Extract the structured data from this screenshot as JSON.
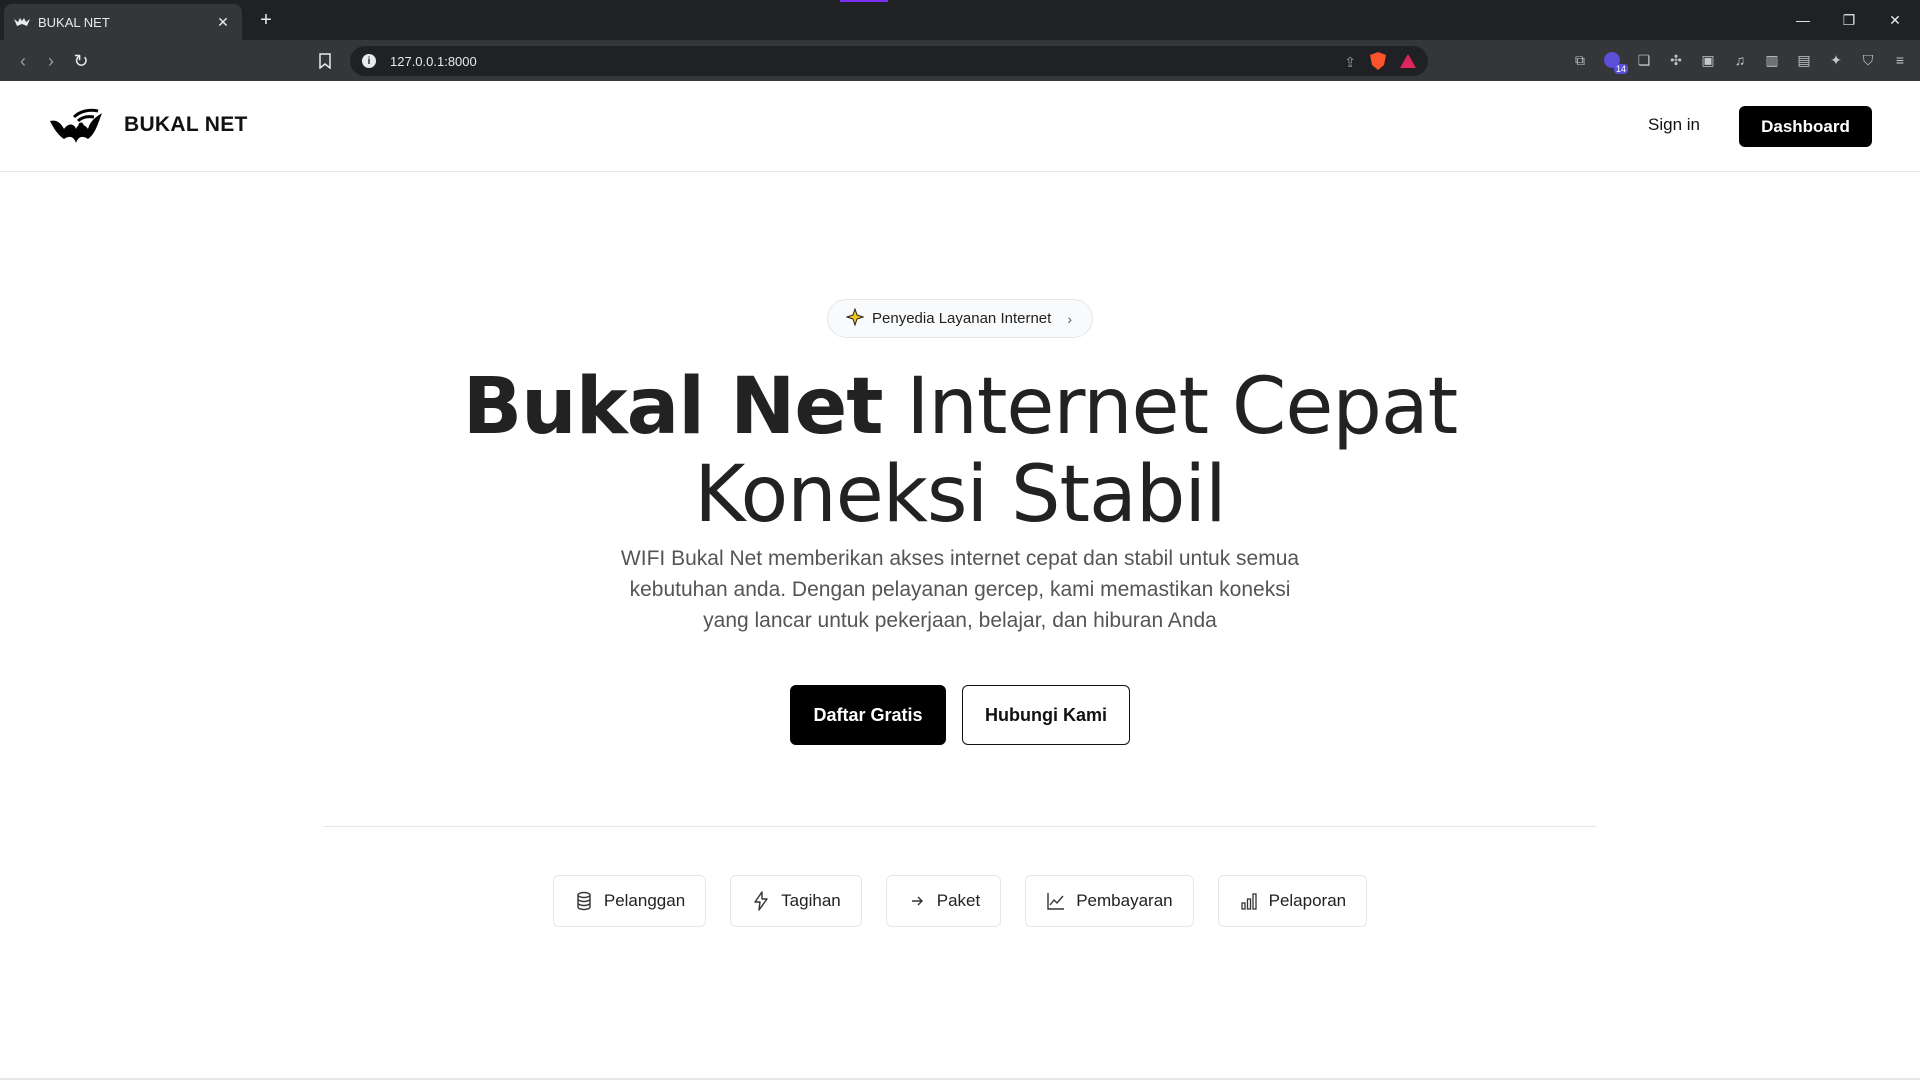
{
  "browser": {
    "tab_title": "BUKAL NET",
    "url": "127.0.0.1:8000",
    "extension_badge": "14"
  },
  "header": {
    "brand": "BUKAL NET",
    "signin_label": "Sign in",
    "dashboard_label": "Dashboard"
  },
  "hero": {
    "pill_label": "Penyedia Layanan Internet",
    "title_bold": "Bukal Net",
    "title_rest_line1": " Internet Cepat",
    "title_line2": "Koneksi Stabil",
    "description": "WIFI Bukal Net memberikan akses internet cepat dan stabil untuk semua kebutuhan anda. Dengan pelayanan gercep, kami memastikan koneksi yang lancar untuk pekerjaan, belajar, dan hiburan Anda",
    "primary_label": "Daftar Gratis",
    "secondary_label": "Hubungi Kami"
  },
  "features": [
    {
      "label": "Pelanggan",
      "icon": "database-icon"
    },
    {
      "label": "Tagihan",
      "icon": "lightning-icon"
    },
    {
      "label": "Paket",
      "icon": "arrow-right-icon"
    },
    {
      "label": "Pembayaran",
      "icon": "line-chart-icon"
    },
    {
      "label": "Pelaporan",
      "icon": "bar-chart-icon"
    }
  ],
  "colors": {
    "primary": "#000000",
    "chrome_dark": "#202124",
    "chrome_tab": "#35363a"
  }
}
